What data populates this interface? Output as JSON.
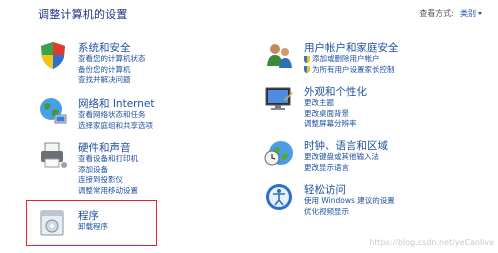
{
  "page_title": "调整计算机的设置",
  "view_by": {
    "label": "查看方式:",
    "value": "类别"
  },
  "left": [
    {
      "title": "系统和安全",
      "links": [
        "查看您的计算机状态",
        "备份您的计算机",
        "查找并解决问题"
      ]
    },
    {
      "title": "网络和 Internet",
      "links": [
        "查看网络状态和任务",
        "选择家庭组和共享选项"
      ]
    },
    {
      "title": "硬件和声音",
      "links": [
        "查看设备和打印机",
        "添加设备",
        "连接到投影仪",
        "调整常用移动设置"
      ]
    },
    {
      "title": "程序",
      "links": [
        "卸载程序"
      ]
    }
  ],
  "right": [
    {
      "title": "用户帐户和家庭安全",
      "links": [
        "添加或删除用户帐户",
        "为所有用户设置家长控制"
      ]
    },
    {
      "title": "外观和个性化",
      "links": [
        "更改主题",
        "更改桌面背景",
        "调整屏幕分辨率"
      ]
    },
    {
      "title": "时钟、语言和区域",
      "links": [
        "更改键盘或其他输入法",
        "更改显示语言"
      ]
    },
    {
      "title": "轻松访问",
      "links": [
        "使用 Windows 建议的设置",
        "优化视频显示"
      ]
    }
  ],
  "watermark": "https://blog.csdn.net/yeCaolive",
  "colors": {
    "link": "#1e50a2",
    "title": "#1e3287",
    "highlight": "#e3242b"
  }
}
